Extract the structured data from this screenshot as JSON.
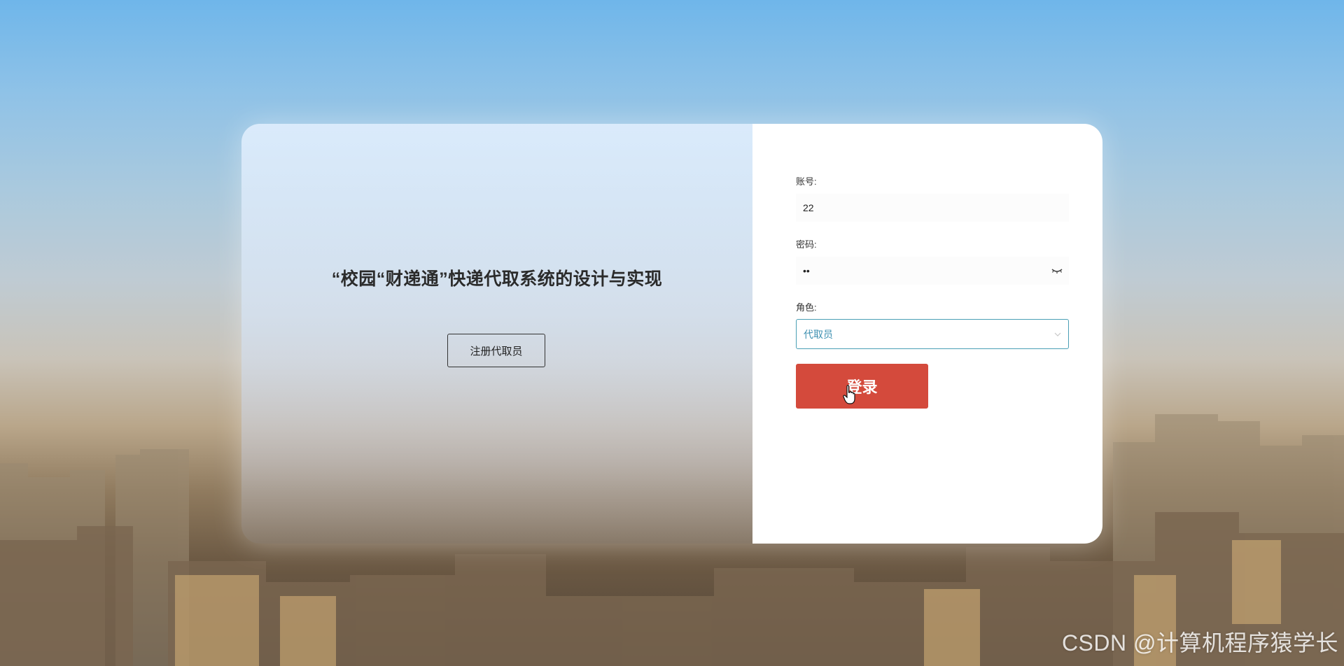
{
  "left_panel": {
    "title": "“校园“财递通”快递代取系统的设计与实现",
    "register_button": "注册代取员"
  },
  "form": {
    "account_label": "账号:",
    "account_value": "22",
    "password_label": "密码:",
    "password_value": "••",
    "role_label": "角色:",
    "role_value": "代取员",
    "login_button": "登录"
  },
  "watermark": "CSDN @计算机程序猿学长",
  "colors": {
    "login_button": "#d44a3c",
    "select_border": "#4a9fb5",
    "select_text": "#3c8fb0"
  },
  "icons": {
    "password_toggle": "eye-closed-icon",
    "select_arrow": "chevron-down-icon",
    "pointer": "hand-cursor-icon"
  }
}
